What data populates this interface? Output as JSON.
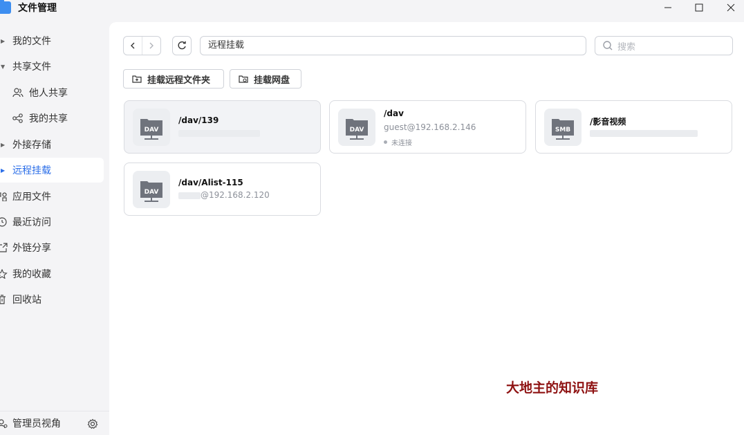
{
  "app": {
    "title": "文件管理"
  },
  "sidebar": {
    "items": [
      {
        "label": "我的文件"
      },
      {
        "label": "共享文件"
      },
      {
        "label": "他人共享"
      },
      {
        "label": "我的共享"
      },
      {
        "label": "外接存储"
      },
      {
        "label": "远程挂载"
      },
      {
        "label": "应用文件"
      },
      {
        "label": "最近访问"
      },
      {
        "label": "外链分享"
      },
      {
        "label": "我的收藏"
      },
      {
        "label": "回收站"
      }
    ],
    "footer": {
      "label": "管理员视角"
    }
  },
  "toolbar": {
    "path": "远程挂载",
    "search_placeholder": "搜索",
    "mount_folder_label": "挂载远程文件夹",
    "mount_netdisk_label": "挂载网盘"
  },
  "mounts": [
    {
      "title": "/dav/139",
      "type_badge": "DAV",
      "subtitle": "",
      "status": ""
    },
    {
      "title": "/dav",
      "type_badge": "DAV",
      "subtitle": "guest@192.168.2.146",
      "status": "未连接"
    },
    {
      "title": "/影音视频",
      "type_badge": "SMB",
      "subtitle": "",
      "status": ""
    },
    {
      "title": "/dav/Alist-115",
      "type_badge": "DAV",
      "subtitle": "@192.168.2.120",
      "status": ""
    }
  ],
  "watermark": "大地主的知识库",
  "colors": {
    "accent": "#2b6ee8",
    "watermark": "#8e1212"
  }
}
